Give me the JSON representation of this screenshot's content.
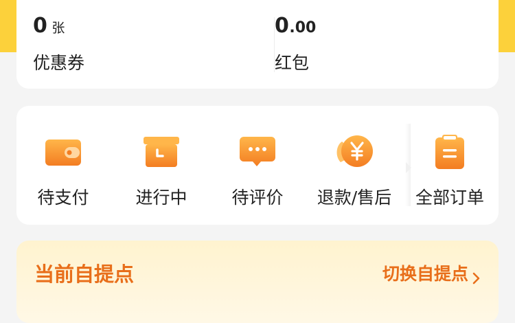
{
  "colors": {
    "brand_yellow": "#fcd13b",
    "icon_orange_light": "#ffb64a",
    "icon_orange_dark": "#f37d22",
    "pickup_text": "#e86e1a"
  },
  "wallet": {
    "coupon": {
      "value": "0",
      "unit": "张",
      "label": "优惠券"
    },
    "redpacket": {
      "value_int": "0",
      "value_dec": ".00",
      "label": "红包"
    }
  },
  "orders": {
    "items": [
      {
        "label": "待支付",
        "icon": "wallet-icon"
      },
      {
        "label": "进行中",
        "icon": "box-icon"
      },
      {
        "label": "待评价",
        "icon": "chat-bubble-icon"
      },
      {
        "label": "退款/售后",
        "icon": "refund-yen-icon"
      },
      {
        "label": "全部订单",
        "icon": "clipboard-icon"
      }
    ]
  },
  "pickup": {
    "title": "当前自提点",
    "switch_label": "切换自提点",
    "switch_icon": "chevron-right-icon"
  }
}
